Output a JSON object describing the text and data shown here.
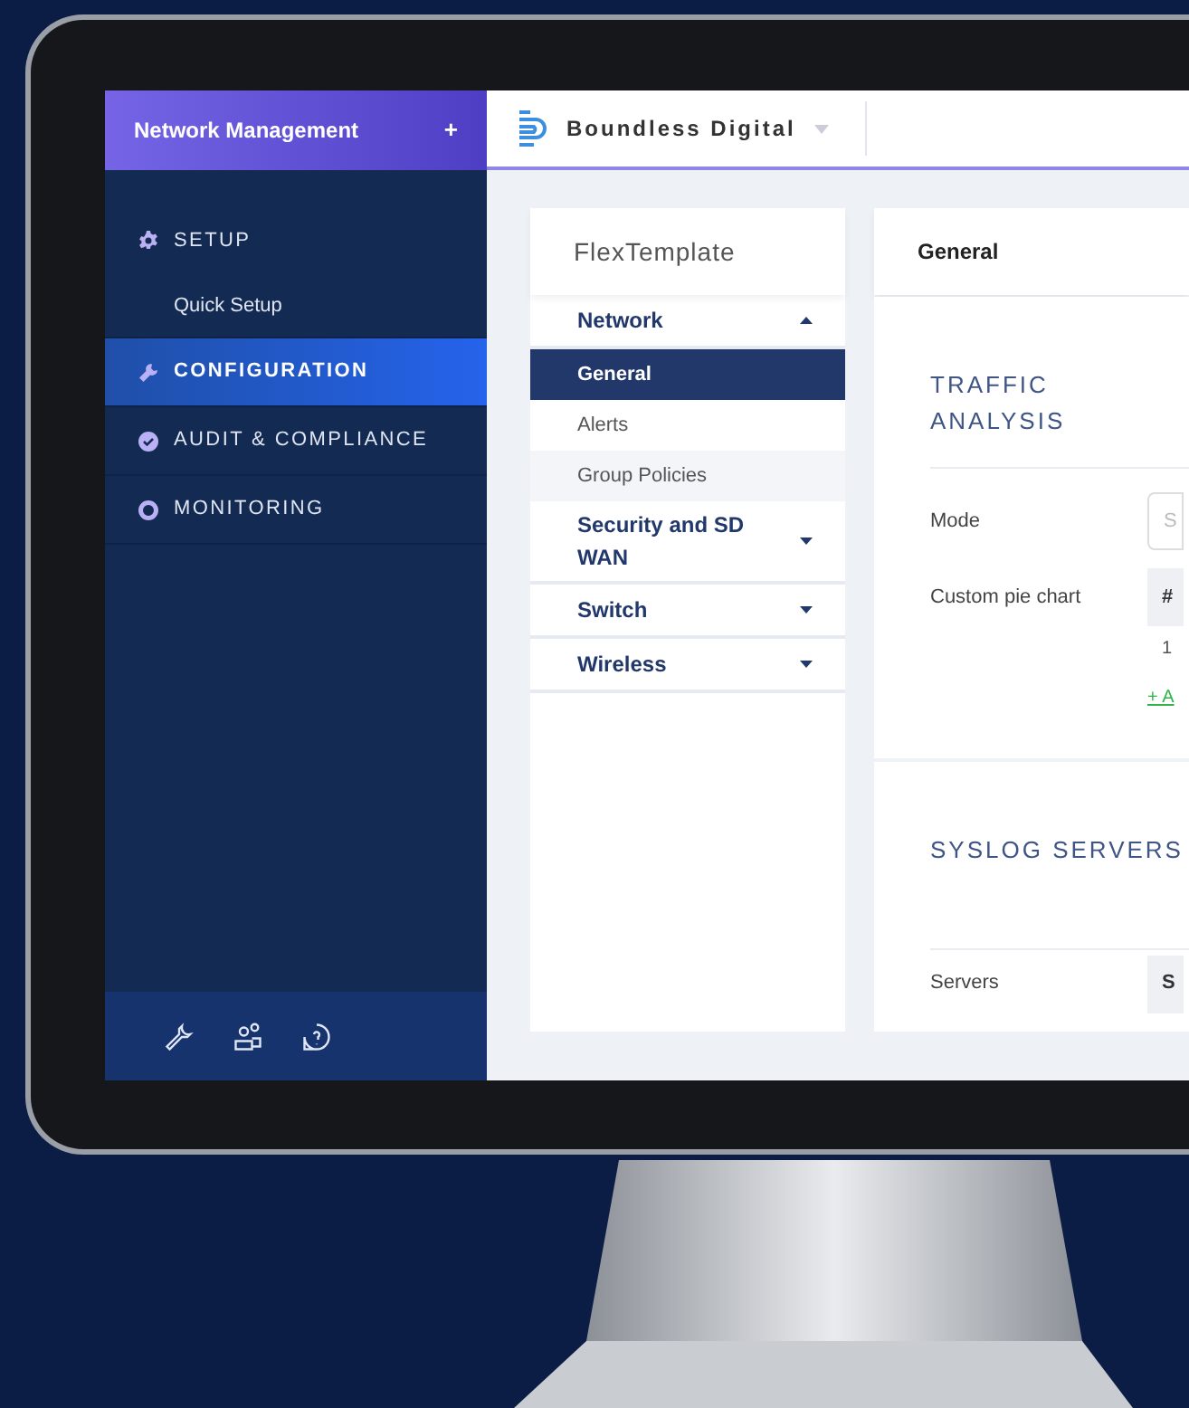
{
  "sidebar": {
    "title": "Network Management",
    "add_button": "+",
    "items": [
      {
        "label": "SETUP",
        "selected": false,
        "children": [
          {
            "label": "Quick Setup",
            "selected": false
          }
        ]
      },
      {
        "label": "CONFIGURATION",
        "selected": true
      },
      {
        "label": "AUDIT & COMPLIANCE",
        "selected": false
      },
      {
        "label": "MONITORING",
        "selected": false
      }
    ]
  },
  "topbar": {
    "brand": "Boundless Digital"
  },
  "template_panel": {
    "title": "FlexTemplate",
    "groups": [
      {
        "label": "Network",
        "expanded": true,
        "children": [
          {
            "label": "General",
            "selected": true
          },
          {
            "label": "Alerts",
            "selected": false
          },
          {
            "label": "Group Policies",
            "selected": false
          }
        ]
      },
      {
        "label": "Security and SD WAN",
        "expanded": false
      },
      {
        "label": "Switch",
        "expanded": false
      },
      {
        "label": "Wireless",
        "expanded": false
      }
    ]
  },
  "main": {
    "title": "General",
    "traffic_analysis": {
      "heading": "TRAFFIC ANALYSIS",
      "mode_label": "Mode",
      "mode_placeholder": "S",
      "pie_label": "Custom pie chart",
      "table_header": "#",
      "table_row": "1",
      "add_link": "+ A"
    },
    "syslog": {
      "heading": "SYSLOG SERVERS",
      "servers_label": "Servers",
      "servers_value": "S"
    }
  }
}
